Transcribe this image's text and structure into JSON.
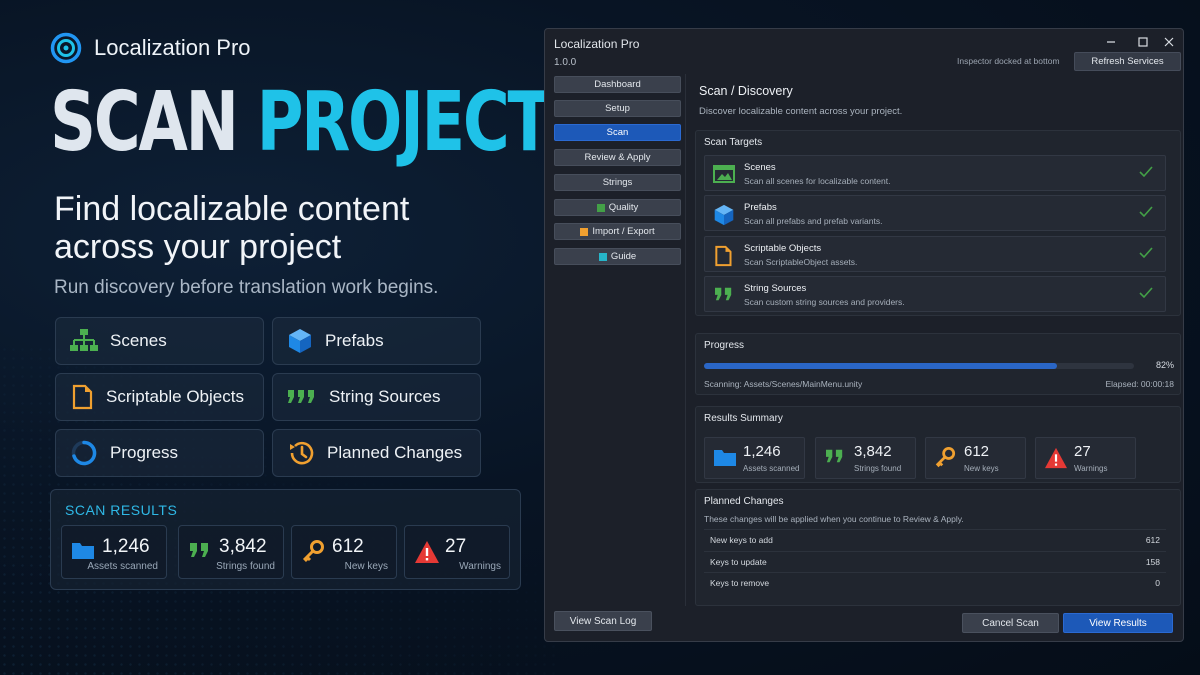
{
  "brand": {
    "name": "Localization Pro"
  },
  "hero": {
    "title_part1": "SCAN",
    "title_part2": "PROJECT",
    "tagline": "Find localizable content across your project",
    "subline": "Run discovery before translation work begins."
  },
  "features": [
    {
      "label": "Scenes",
      "icon": "hierarchy-icon"
    },
    {
      "label": "Prefabs",
      "icon": "cube-icon"
    },
    {
      "label": "Scriptable Objects",
      "icon": "document-icon"
    },
    {
      "label": "String Sources",
      "icon": "quote-icon"
    },
    {
      "label": "Progress",
      "icon": "progress-ring-icon"
    },
    {
      "label": "Planned Changes",
      "icon": "history-icon"
    }
  ],
  "scan_results": {
    "title": "SCAN RESULTS",
    "cards": [
      {
        "value": "1,246",
        "label": "Assets scanned",
        "icon": "folder-icon"
      },
      {
        "value": "3,842",
        "label": "Strings found",
        "icon": "quote-icon"
      },
      {
        "value": "612",
        "label": "New keys",
        "icon": "key-icon"
      },
      {
        "value": "27",
        "label": "Warnings",
        "icon": "warning-icon"
      }
    ]
  },
  "window": {
    "title": "Localization Pro",
    "version": "1.0.0",
    "inspector_note": "Inspector docked at bottom",
    "refresh_label": "Refresh Services",
    "nav": [
      {
        "label": "Dashboard"
      },
      {
        "label": "Setup"
      },
      {
        "label": "Scan",
        "active": true
      },
      {
        "label": "Review & Apply"
      },
      {
        "label": "Strings"
      },
      {
        "label": "Quality",
        "marker": "#43a047"
      },
      {
        "label": "Import / Export",
        "marker": "#f0a030"
      },
      {
        "label": "Guide",
        "marker": "#26b5c9"
      }
    ],
    "heading": "Scan / Discovery",
    "subheading": "Discover localizable content across your project.",
    "targets": {
      "title": "Scan Targets",
      "items": [
        {
          "name": "Scenes",
          "desc": "Scan all scenes for localizable content.",
          "icon": "scene-icon",
          "checked": true
        },
        {
          "name": "Prefabs",
          "desc": "Scan all prefabs and prefab variants.",
          "icon": "cube-icon",
          "checked": true
        },
        {
          "name": "Scriptable Objects",
          "desc": "Scan ScriptableObject assets.",
          "icon": "document-icon",
          "checked": true
        },
        {
          "name": "String Sources",
          "desc": "Scan custom string sources and providers.",
          "icon": "quote-icon",
          "checked": true
        }
      ]
    },
    "progress": {
      "title": "Progress",
      "percent_label": "82%",
      "percent": 82,
      "scanning": "Scanning: Assets/Scenes/MainMenu.unity",
      "elapsed": "Elapsed: 00:00:18"
    },
    "summary": {
      "title": "Results Summary",
      "cards": [
        {
          "value": "1,246",
          "label": "Assets scanned",
          "icon": "folder-icon"
        },
        {
          "value": "3,842",
          "label": "Strings found",
          "icon": "quote-icon"
        },
        {
          "value": "612",
          "label": "New keys",
          "icon": "key-icon"
        },
        {
          "value": "27",
          "label": "Warnings",
          "icon": "warning-icon"
        }
      ]
    },
    "planned": {
      "title": "Planned Changes",
      "desc": "These changes will be applied when you continue to Review & Apply.",
      "rows": [
        {
          "key": "New keys to add",
          "value": "612"
        },
        {
          "key": "Keys to update",
          "value": "158"
        },
        {
          "key": "Keys to remove",
          "value": "0"
        }
      ]
    },
    "buttons": {
      "view_log": "View Scan Log",
      "cancel": "Cancel Scan",
      "view_results": "View Results"
    }
  },
  "colors": {
    "accent": "#1fc2e8",
    "active_blue": "#1d59b8",
    "success": "#43a047",
    "warning": "#e53935",
    "key": "#f0a030"
  }
}
